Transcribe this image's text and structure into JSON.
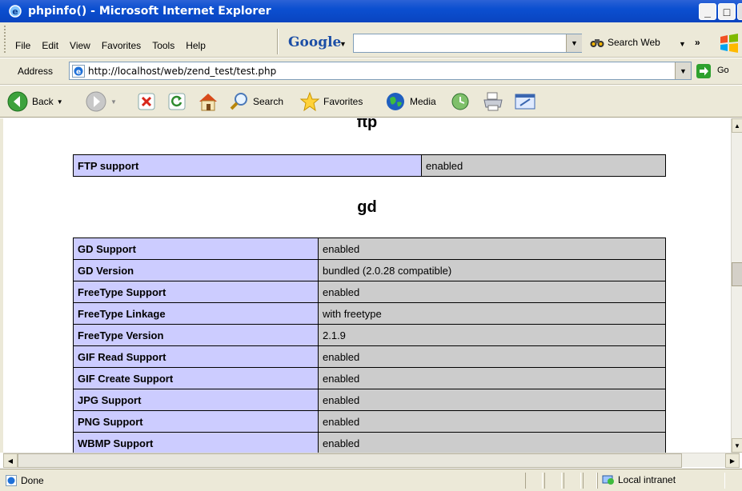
{
  "window": {
    "title": "phpinfo() - Microsoft Internet Explorer",
    "min_glyph": "_",
    "max_glyph": "□",
    "close_glyph": "×"
  },
  "menu": {
    "items": [
      "File",
      "Edit",
      "View",
      "Favorites",
      "Tools",
      "Help"
    ],
    "google_logo": "Google",
    "google_query": "",
    "search_web_label": "Search Web",
    "overflow_glyph": "»"
  },
  "address": {
    "label": "Address",
    "url": "http://localhost/web/zend_test/test.php",
    "go_label": "Go"
  },
  "toolbar": {
    "back_label": "Back",
    "search_label": "Search",
    "favorites_label": "Favorites",
    "media_label": "Media"
  },
  "page": {
    "ftp_heading": "ftp",
    "ftp_rows": [
      {
        "key": "FTP support",
        "value": "enabled"
      }
    ],
    "gd_heading": "gd",
    "gd_rows": [
      {
        "key": "GD Support",
        "value": "enabled"
      },
      {
        "key": "GD Version",
        "value": "bundled (2.0.28 compatible)"
      },
      {
        "key": "FreeType Support",
        "value": "enabled"
      },
      {
        "key": "FreeType Linkage",
        "value": "with freetype"
      },
      {
        "key": "FreeType Version",
        "value": "2.1.9"
      },
      {
        "key": "GIF Read Support",
        "value": "enabled"
      },
      {
        "key": "GIF Create Support",
        "value": "enabled"
      },
      {
        "key": "JPG Support",
        "value": "enabled"
      },
      {
        "key": "PNG Support",
        "value": "enabled"
      },
      {
        "key": "WBMP Support",
        "value": "enabled"
      }
    ]
  },
  "status": {
    "text": "Done",
    "zone": "Local intranet"
  },
  "colors": {
    "titlebar": "#0a44c0",
    "key_cell": "#ccccff",
    "value_cell": "#cccccc",
    "chrome": "#ece9d8"
  }
}
